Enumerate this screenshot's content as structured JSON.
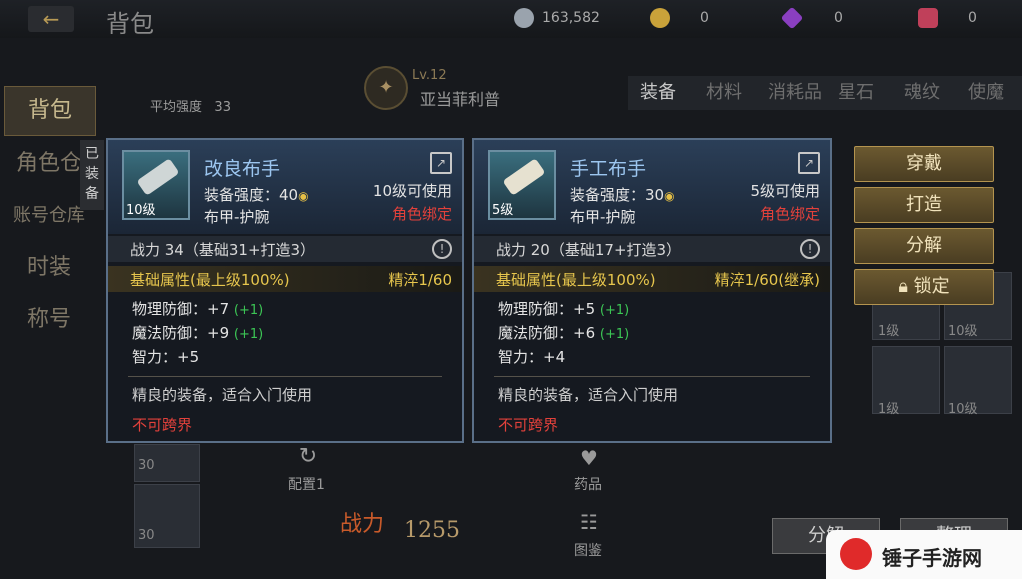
{
  "header": {
    "back_icon": "back-arrow-icon",
    "title": "背包",
    "currencies": [
      {
        "icon": "silver-coin-icon",
        "value": "163,582"
      },
      {
        "icon": "gold-coin-icon",
        "value": "0"
      },
      {
        "icon": "diamond-icon",
        "value": "0"
      },
      {
        "icon": "gift-gem-icon",
        "value": "0"
      }
    ]
  },
  "left_nav": [
    "背包",
    "角色仓",
    "账号仓库",
    "时装",
    "称号"
  ],
  "worn_tab": "已装备",
  "avg_strength": {
    "label": "平均强度",
    "value": "33"
  },
  "character": {
    "level": "Lv.12",
    "name": "亚当菲利普"
  },
  "right_tabs": [
    "装备",
    "材料",
    "消耗品",
    "星石",
    "魂纹",
    "使魔"
  ],
  "grid_levels": [
    "1级",
    "10级",
    "1级",
    "10级"
  ],
  "actions": {
    "wear": "穿戴",
    "forge": "打造",
    "decompose": "分解",
    "lock": "锁定"
  },
  "tooltips": [
    {
      "name": "改良布手",
      "icon_level": "10级",
      "strength_label": "装备强度：40",
      "requirement": "10级可使用",
      "category": "布甲-护腕",
      "bind": "角色绑定",
      "power": "战力 34（基础31+打造3）",
      "base_label": "基础属性(最上级100%)",
      "refine": "精淬1/60",
      "stats": [
        {
          "text": "物理防御：+7",
          "plus": "(+1)"
        },
        {
          "text": "魔法防御：+9",
          "plus": "(+1)"
        },
        {
          "text": "智力：+5",
          "plus": ""
        }
      ],
      "desc": "精良的装备，适合入门使用",
      "cross": "不可跨界"
    },
    {
      "name": "手工布手",
      "icon_level": "5级",
      "strength_label": "装备强度：30",
      "requirement": "5级可使用",
      "category": "布甲-护腕",
      "bind": "角色绑定",
      "power": "战力 20（基础17+打造3）",
      "base_label": "基础属性(最上级100%)",
      "refine": "精淬1/60(继承)",
      "stats": [
        {
          "text": "物理防御：+5",
          "plus": "(+1)"
        },
        {
          "text": "魔法防御：+6",
          "plus": "(+1)"
        },
        {
          "text": "智力：+4",
          "plus": ""
        }
      ],
      "desc": "精良的装备，适合入门使用",
      "cross": "不可跨界"
    }
  ],
  "bottom": {
    "slot_levels": [
      "30",
      "30"
    ],
    "config": "配置1",
    "potion": "药品",
    "codex": "图鉴",
    "combat_label": "战力",
    "combat_value": "1255",
    "btn_left": "分解",
    "btn_right": "整理"
  },
  "watermark": "锤子手游网"
}
